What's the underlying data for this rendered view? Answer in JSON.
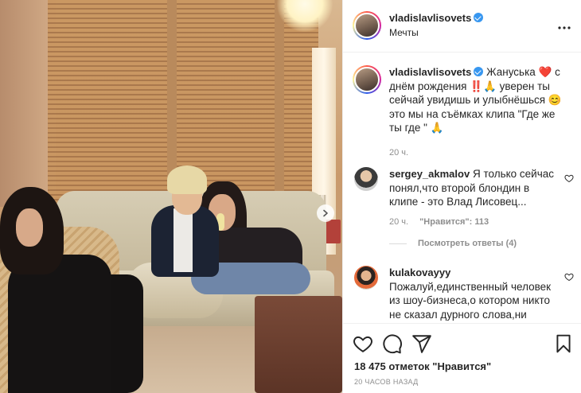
{
  "post": {
    "username": "vladislavlisovets",
    "location": "Мечты",
    "more_icon": "more-horizontal-icon",
    "caption": {
      "username": "vladislavlisovets",
      "text": "Жануська ❤️ с днём рождения ‼️🙏 уверен ты сейчай увидишь и улыбнёшься 😊 это мы на съёмках клипа \"Где же ты где \" 🙏",
      "time": "20 ч."
    }
  },
  "comments": [
    {
      "username": "sergey_akmalov",
      "text": "Я только сейчас понял,что второй блондин в клипе - это Влад Лисовец...",
      "time": "20 ч.",
      "likes_label": "\"Нравится\": 113",
      "replies_label": "Посмотреть ответы (4)"
    },
    {
      "username": "kulakovayyy",
      "text": "Пожалуй,единственный человек из шоу-бизнеса,о котором никто не сказал дурного слова,ни одного плохого слова"
    }
  ],
  "actions": {
    "like_icon": "heart-icon",
    "comment_icon": "comment-icon",
    "share_icon": "send-icon",
    "save_icon": "bookmark-icon",
    "likes_text": "18 475 отметок \"Нравится\"",
    "posted_ago": "20 часов назад"
  },
  "colors": {
    "verified": "#3897f0",
    "muted": "#8e8e8e",
    "text": "#262626"
  }
}
